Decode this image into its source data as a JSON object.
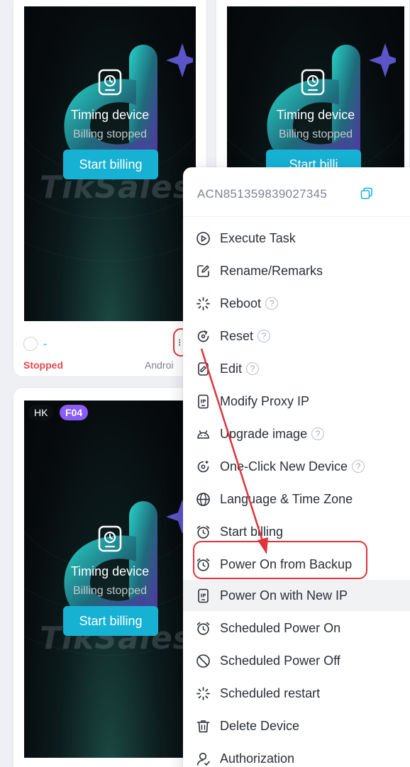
{
  "cards": [
    {
      "timing_title": "Timing device",
      "billing_status": "Billing stopped",
      "start_button": "Start billing",
      "watermark": "TikSales"
    },
    {
      "timing_title": "Timing device",
      "billing_status": "Billing stopped",
      "start_button": "Start billi"
    },
    {
      "region_badge": "HK",
      "tag_badge": "F04",
      "timing_title": "Timing device",
      "billing_status": "Billing stopped",
      "start_button": "Start billing",
      "watermark": "TikSales"
    }
  ],
  "card_footer": {
    "name": "-",
    "status": "Stopped",
    "os": "Androi",
    "more_glyph": "⁝"
  },
  "menu": {
    "device_id": "ACN851359839027345",
    "items": [
      {
        "label": "Execute Task",
        "icon": "play-circle-icon",
        "help": false
      },
      {
        "label": "Rename/Remarks",
        "icon": "edit-square-icon",
        "help": false
      },
      {
        "label": "Reboot",
        "icon": "loading-icon",
        "help": true
      },
      {
        "label": "Reset",
        "icon": "reset-icon",
        "help": true
      },
      {
        "label": "Edit",
        "icon": "phone-edit-icon",
        "help": true
      },
      {
        "label": "Modify Proxy IP",
        "icon": "ip-icon",
        "help": false
      },
      {
        "label": "Upgrade image",
        "icon": "android-icon",
        "help": true
      },
      {
        "label": "One-Click New Device",
        "icon": "new-device-icon",
        "help": true
      },
      {
        "label": "Language & Time Zone",
        "icon": "globe-icon",
        "help": false
      },
      {
        "label": "Start billing",
        "icon": "alarm-clock-icon",
        "help": false
      },
      {
        "label": "Power On from Backup",
        "icon": "alarm-clock-icon",
        "help": false
      },
      {
        "label": "Power On with New IP",
        "icon": "ip-icon",
        "help": false
      },
      {
        "label": "Scheduled Power On",
        "icon": "alarm-clock-icon",
        "help": false
      },
      {
        "label": "Scheduled Power Off",
        "icon": "stop-circle-icon",
        "help": false
      },
      {
        "label": "Scheduled restart",
        "icon": "loading-icon",
        "help": false
      },
      {
        "label": "Delete Device",
        "icon": "trash-icon",
        "help": false
      },
      {
        "label": "Authorization",
        "icon": "user-icon",
        "help": false
      }
    ],
    "help_glyph": "?"
  },
  "colors": {
    "accent": "#17b1d4",
    "highlight": "#e0323c",
    "stopped": "#e5484d",
    "f04_badge": "#8b5cf6"
  }
}
